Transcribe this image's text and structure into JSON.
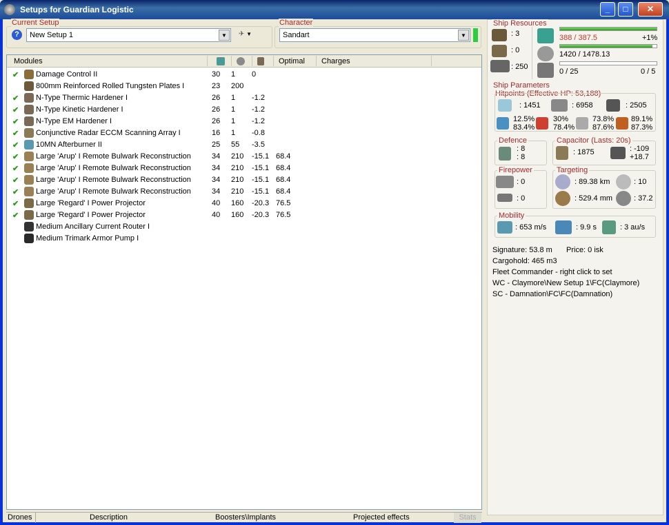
{
  "window": {
    "title": "Setups for Guardian Logistic"
  },
  "setup": {
    "label": "Current Setup",
    "value": "New Setup 1"
  },
  "character": {
    "label": "Character",
    "value": "Sandart"
  },
  "modules": {
    "headers": [
      "Modules",
      "Optimal",
      "Charges"
    ],
    "rows": [
      {
        "checked": true,
        "name": "Damage Control II",
        "cpu": "30",
        "pg": "1",
        "cap": "0",
        "optimal": "",
        "ic": "#8a6d3b"
      },
      {
        "checked": false,
        "name": "800mm Reinforced Rolled Tungsten Plates I",
        "cpu": "23",
        "pg": "200",
        "cap": "",
        "optimal": "",
        "ic": "#6d5a3a"
      },
      {
        "checked": true,
        "name": "N-Type Thermic Hardener I",
        "cpu": "26",
        "pg": "1",
        "cap": "-1.2",
        "optimal": "",
        "ic": "#7a6a55"
      },
      {
        "checked": true,
        "name": "N-Type Kinetic Hardener I",
        "cpu": "26",
        "pg": "1",
        "cap": "-1.2",
        "optimal": "",
        "ic": "#7a6a55"
      },
      {
        "checked": true,
        "name": "N-Type EM Hardener I",
        "cpu": "26",
        "pg": "1",
        "cap": "-1.2",
        "optimal": "",
        "ic": "#7a6a55"
      },
      {
        "checked": true,
        "name": "Conjunctive Radar ECCM Scanning Array I",
        "cpu": "16",
        "pg": "1",
        "cap": "-0.8",
        "optimal": "",
        "ic": "#8a7a55"
      },
      {
        "checked": true,
        "name": "10MN Afterburner II",
        "cpu": "25",
        "pg": "55",
        "cap": "-3.5",
        "optimal": "",
        "ic": "#5a9ab0"
      },
      {
        "checked": true,
        "name": "Large 'Arup' I Remote Bulwark Reconstruction",
        "cpu": "34",
        "pg": "210",
        "cap": "-15.1",
        "optimal": "68.4",
        "ic": "#9a8055"
      },
      {
        "checked": true,
        "name": "Large 'Arup' I Remote Bulwark Reconstruction",
        "cpu": "34",
        "pg": "210",
        "cap": "-15.1",
        "optimal": "68.4",
        "ic": "#9a8055"
      },
      {
        "checked": true,
        "name": "Large 'Arup' I Remote Bulwark Reconstruction",
        "cpu": "34",
        "pg": "210",
        "cap": "-15.1",
        "optimal": "68.4",
        "ic": "#9a8055"
      },
      {
        "checked": true,
        "name": "Large 'Arup' I Remote Bulwark Reconstruction",
        "cpu": "34",
        "pg": "210",
        "cap": "-15.1",
        "optimal": "68.4",
        "ic": "#9a8055"
      },
      {
        "checked": true,
        "name": "Large 'Regard' I Power Projector",
        "cpu": "40",
        "pg": "160",
        "cap": "-20.3",
        "optimal": "76.5",
        "ic": "#7a6a45"
      },
      {
        "checked": true,
        "name": "Large 'Regard' I Power Projector",
        "cpu": "40",
        "pg": "160",
        "cap": "-20.3",
        "optimal": "76.5",
        "ic": "#7a6a45"
      },
      {
        "checked": false,
        "name": "Medium Ancillary Current Router I",
        "cpu": "",
        "pg": "",
        "cap": "",
        "optimal": "",
        "ic": "#333333"
      },
      {
        "checked": false,
        "name": "Medium Trimark Armor Pump I",
        "cpu": "",
        "pg": "",
        "cap": "",
        "optimal": "",
        "ic": "#2a2a2a"
      }
    ]
  },
  "tabs": [
    "Drones",
    "Description",
    "Boosters\\Implants",
    "Projected effects",
    "Stats"
  ],
  "resources": {
    "title": "Ship Resources",
    "hi": ": 3",
    "med": ": 0",
    "drone": ": 250",
    "cpu": "388 / 387.5",
    "cpu_pct": "+1%",
    "pg": "1420 / 1478.13",
    "cal": "0 / 25",
    "cal2": "0 / 5",
    "cpu_fill": 1.0,
    "pg_fill": 0.96,
    "cal_fill": 0.0
  },
  "params": {
    "title": "Ship Parameters",
    "hp_title": "Hitpoints (Effective HP: 53,188)",
    "shield": ": 1451",
    "armor": ": 6958",
    "hull": ": 2505",
    "r1a": "12.5%",
    "r1b": "83.4%",
    "r2a": "30%",
    "r2b": "78.4%",
    "r3a": "73.8%",
    "r3b": "87.6%",
    "r4a": "89.1%",
    "r4b": "87.3%"
  },
  "defence": {
    "title": "Defence",
    "a": ": 8",
    "b": ": 8"
  },
  "capacitor": {
    "title": "Capacitor (Lasts: 20s)",
    "cap": ": 1875",
    "d1": ": -109",
    "d2": "+18.7"
  },
  "firepower": {
    "title": "Firepower",
    "a": ": 0",
    "b": ": 0"
  },
  "targeting": {
    "title": "Targeting",
    "range": ": 89.38 km",
    "targets": ": 10",
    "res": ": 529.4 mm",
    "scan": ": 37.2"
  },
  "mobility": {
    "title": "Mobility",
    "speed": ": 653 m/s",
    "align": ": 9.9 s",
    "warp": ": 3 au/s"
  },
  "info": {
    "sig": "Signature: 53.8 m",
    "price": "Price: 0 isk",
    "cargo": "Cargohold: 465 m3",
    "fleet": "Fleet Commander - right click to set",
    "wc": "WC - Claymore\\New Setup 1\\FC(Claymore)",
    "sc": "SC - Damnation\\FC\\FC(Damnation)"
  }
}
